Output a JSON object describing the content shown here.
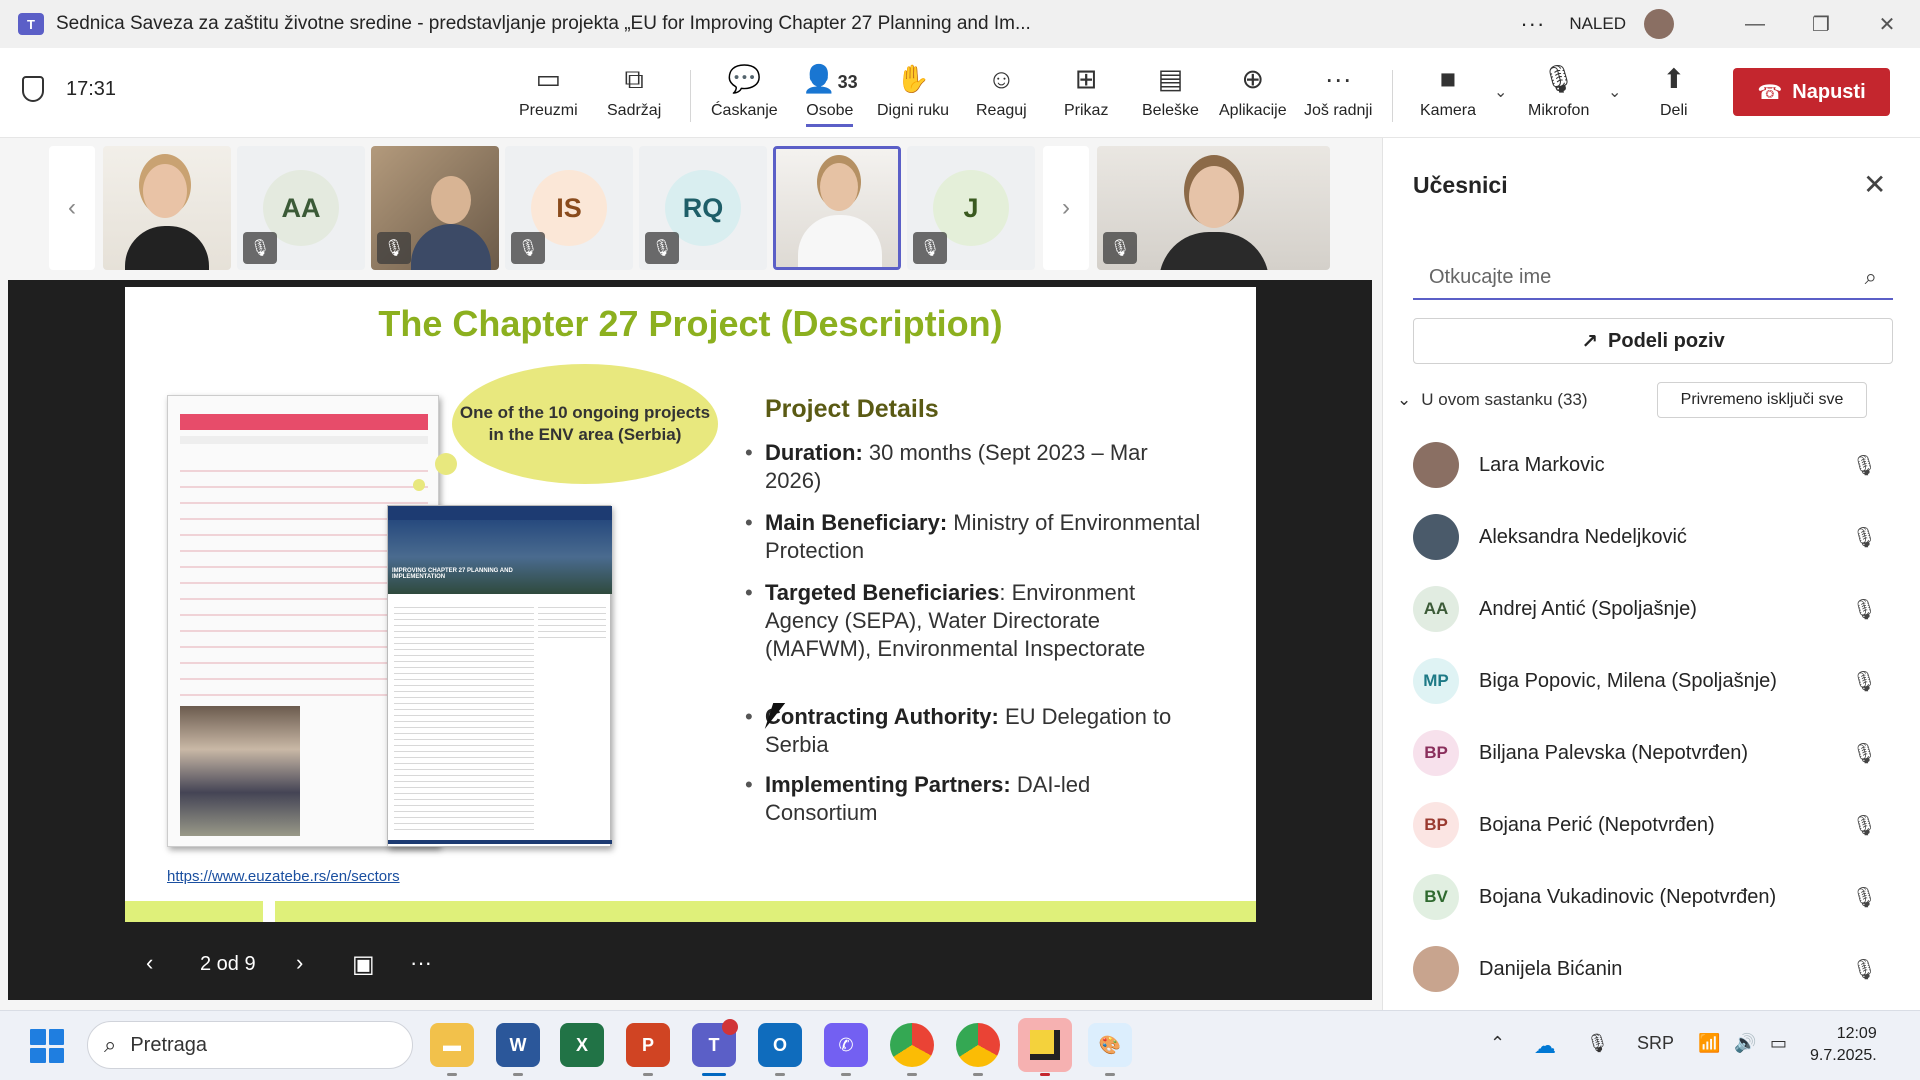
{
  "titlebar": {
    "title": "Sednica Saveza za zaštitu životne sredine - predstavljanje projekta „EU for Improving Chapter 27 Planning and Im...",
    "more": "···",
    "org": "NALED",
    "minimize": "—",
    "restore": "❐",
    "close": "✕"
  },
  "toolbar": {
    "time": "17:31",
    "take_control": "Preuzmi",
    "share_content": "Sadržaj",
    "chat": "Ćaskanje",
    "people": "Osobe",
    "people_count": "33",
    "raise_hand": "Digni ruku",
    "react": "Reaguj",
    "view": "Prikaz",
    "notes": "Beleške",
    "apps": "Aplikacije",
    "more": "Još radnji",
    "camera": "Kamera",
    "mic": "Mikrofon",
    "share": "Deli",
    "leave": "Napusti"
  },
  "gallery": {
    "tiles": [
      {
        "initials": ""
      },
      {
        "initials": "AA"
      },
      {
        "initials": ""
      },
      {
        "initials": "IS"
      },
      {
        "initials": "RQ"
      },
      {
        "initials": ""
      },
      {
        "initials": "J"
      },
      {
        "initials": ""
      }
    ]
  },
  "slide": {
    "title": "The Chapter 27 Project (Description)",
    "bubble": "One of the 10 ongoing projects  in the ENV area (Serbia)",
    "details_title": "Project Details",
    "bullets": [
      {
        "bold": "Duration:",
        "text": " 30 months (Sept 2023 – Mar 2026)"
      },
      {
        "bold": "Main Beneficiary:",
        "text": " Ministry of Environmental Protection"
      },
      {
        "bold": "Targeted Beneficiaries",
        "text": ": Environment Agency (SEPA), Water Directorate (MAFWM), Environmental Inspectorate"
      },
      {
        "bold": "Contracting Authority:",
        "text": " EU Delegation to Serbia"
      },
      {
        "bold": "Implementing Partners:",
        "text": " DAI-led Consortium"
      }
    ],
    "link": "https://www.euzatebe.rs/en/sectors",
    "doc_heading": "IMPROVING CHAPTER 27 PLANNING AND IMPLEMENTATION"
  },
  "slide_controls": {
    "page": "2 od 9"
  },
  "panel": {
    "title": "Učesnici",
    "search_placeholder": "Otkucajte ime",
    "share_invite": "Podeli poziv",
    "section": "U ovom sastanku (33)",
    "mute_all": "Privremeno isključi sve",
    "participants": [
      {
        "initials": "",
        "name": "Lara Markovic",
        "color": "#8a6f63"
      },
      {
        "initials": "",
        "name": "Aleksandra Nedeljković",
        "color": "#4a5a6a"
      },
      {
        "initials": "AA",
        "name": "Andrej Antić (Spoljašnje)",
        "color": "#e1ece1"
      },
      {
        "initials": "MP",
        "name": "Biga Popovic, Milena (Spoljašnje)",
        "color": "#dff3f4"
      },
      {
        "initials": "BP",
        "name": "Biljana Palevska (Nepotvrđen)",
        "color": "#f7e1ec"
      },
      {
        "initials": "BP",
        "name": "Bojana Perić (Nepotvrđen)",
        "color": "#fbe5e3"
      },
      {
        "initials": "BV",
        "name": "Bojana Vukadinovic (Nepotvrđen)",
        "color": "#e1efe1"
      },
      {
        "initials": "",
        "name": "Danijela Bićanin",
        "color": "#c8a48e"
      }
    ]
  },
  "taskbar": {
    "search": "Pretraga",
    "lang": "SRP",
    "time": "12:09",
    "date": "9.7.2025."
  }
}
